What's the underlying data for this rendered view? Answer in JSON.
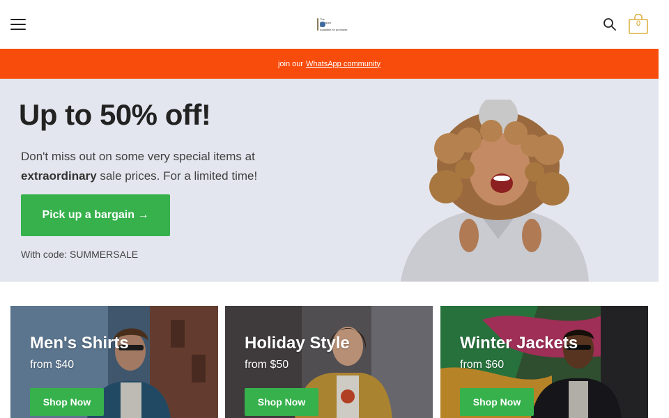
{
  "header": {
    "logo_lines": [
      "The",
      "Premium",
      "Box"
    ],
    "logo_tagline": "Available for purchase",
    "cart_count": "0"
  },
  "promo": {
    "text": "join our",
    "link": "WhatsApp community"
  },
  "hero": {
    "title": "Up to 50% off!",
    "text_line1": "Don't miss out on some very special items at",
    "text_bold": "extraordinary",
    "text_rest": " sale prices. For a limited time!",
    "cta": "Pick up a bargain →",
    "code": "With code: SUMMERSALE"
  },
  "categories": [
    {
      "title": "Men's Shirts",
      "price": "from $40",
      "button": "Shop Now"
    },
    {
      "title": "Holiday Style",
      "price": "from $50",
      "button": "Shop Now"
    },
    {
      "title": "Winter Jackets",
      "price": "from $60",
      "button": "Shop Now"
    }
  ],
  "colors": {
    "promo_bar": "#f84c0d",
    "accent_green": "#36b14c",
    "hero_bg": "#e3e6ee",
    "cart_yellow": "#d4a11c"
  }
}
